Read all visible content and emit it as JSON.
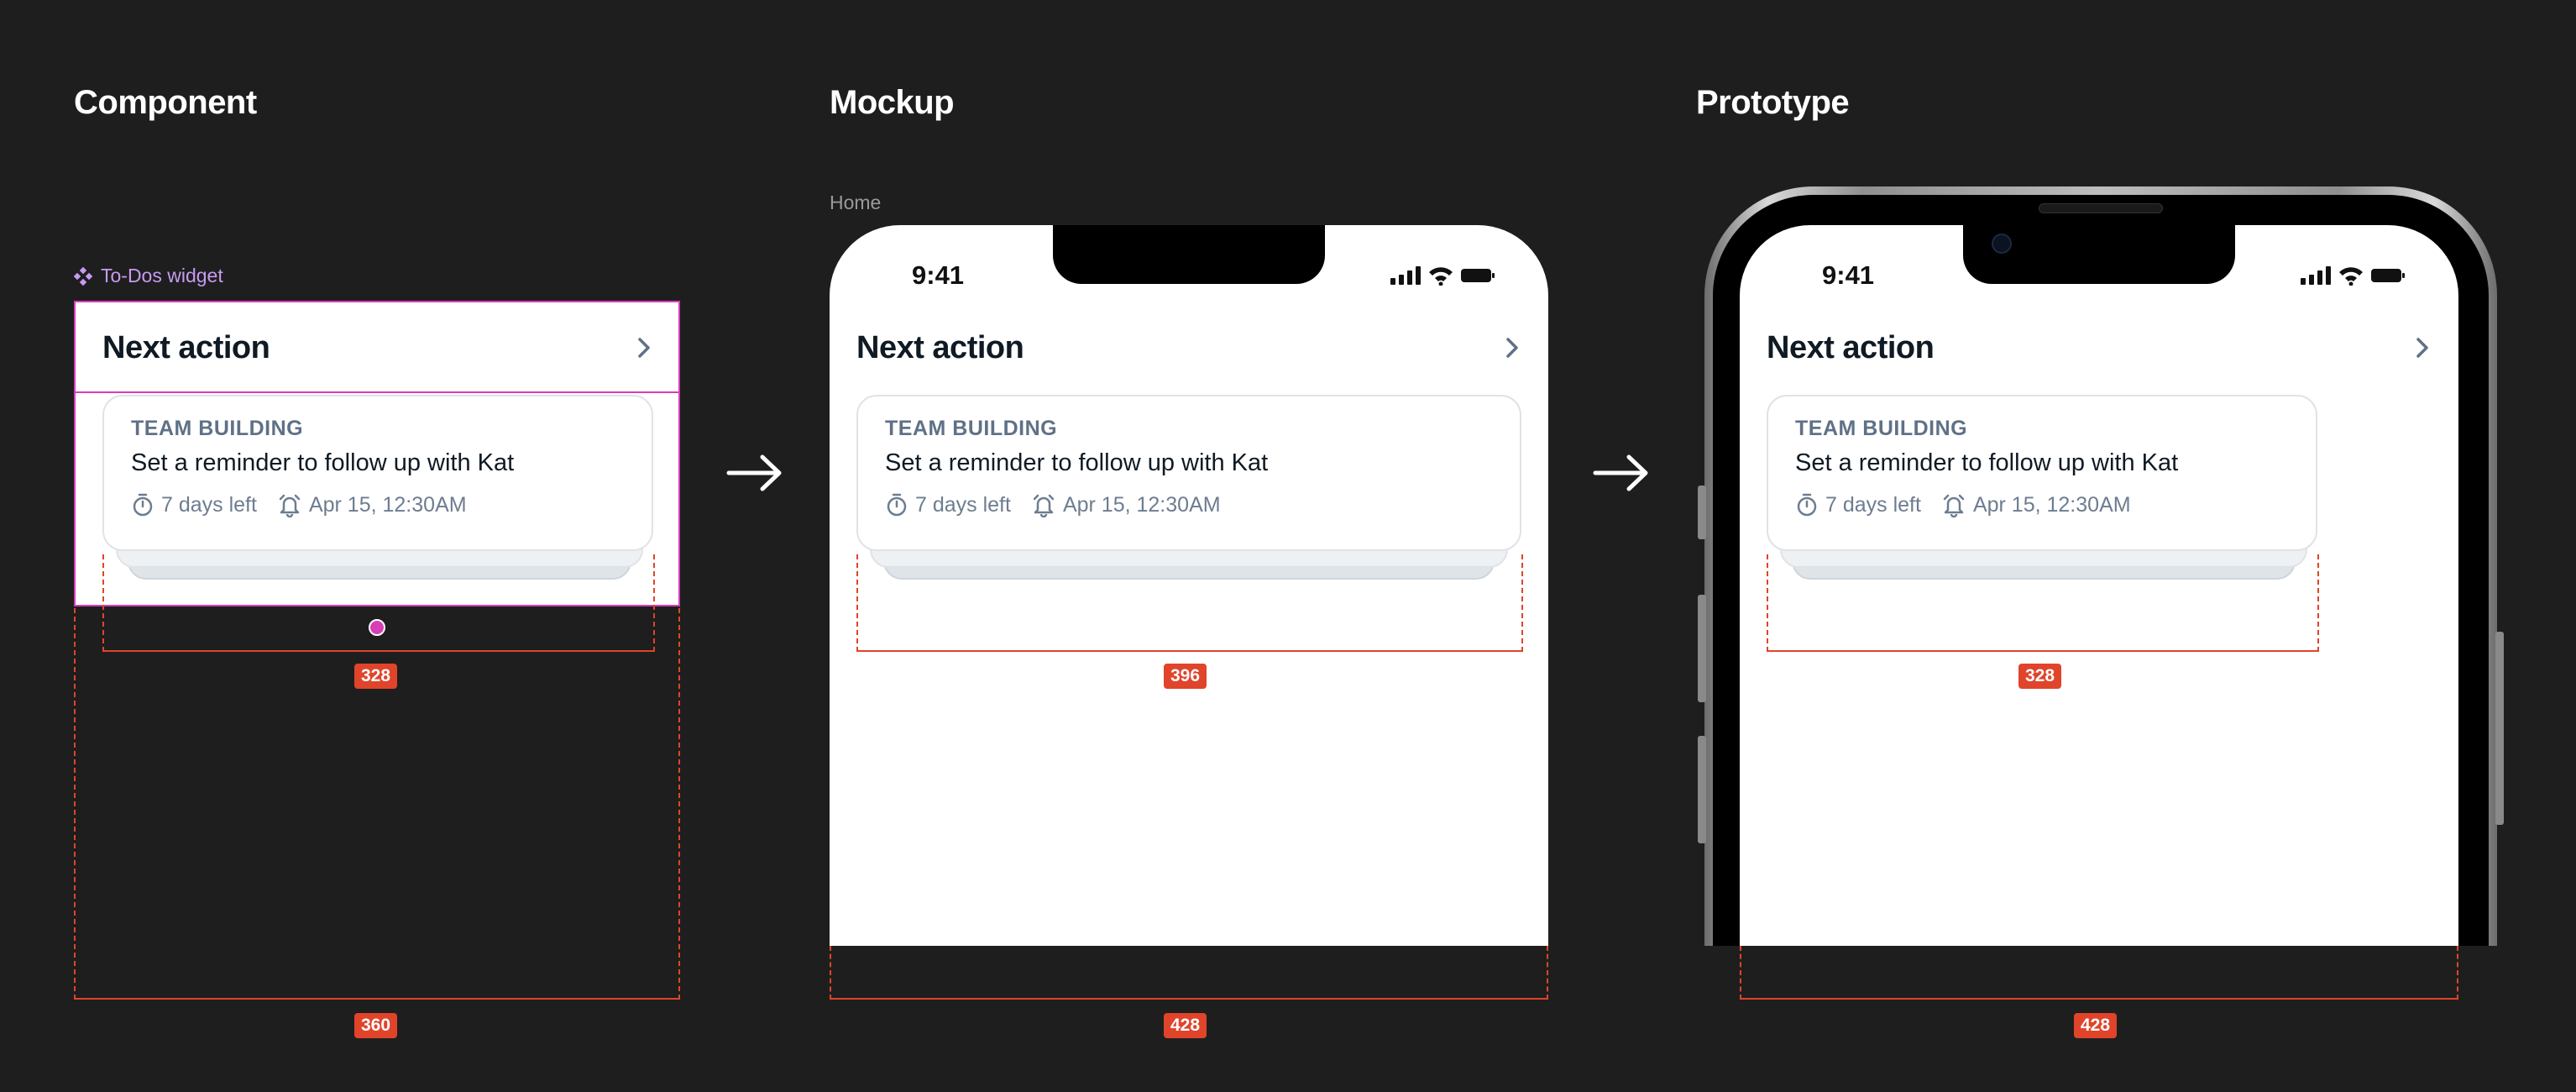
{
  "sections": {
    "component": {
      "title": "Component",
      "layer_label": "To-Dos widget"
    },
    "mockup": {
      "title": "Mockup",
      "frame_label": "Home"
    },
    "prototype": {
      "title": "Prototype"
    }
  },
  "status_bar": {
    "time": "9:41"
  },
  "widget": {
    "title": "Next action",
    "card": {
      "category": "TEAM BUILDING",
      "task": "Set a reminder to follow up with Kat",
      "time_left": "7 days left",
      "reminder": "Apr 15, 12:30AM"
    }
  },
  "dimensions": {
    "component_card_width": "328",
    "component_frame_width": "360",
    "mockup_card_width": "396",
    "mockup_frame_width": "428",
    "prototype_card_width": "328",
    "prototype_frame_width": "428"
  },
  "colors": {
    "background": "#1e1e1e",
    "dimension": "#e0442a",
    "selection": "#d63fb6",
    "component_label": "#c79bf2",
    "category_text": "#5f7187"
  },
  "icons": {
    "component": "component-icon",
    "chevron": "chevron-right-icon",
    "timer": "timer-icon",
    "alarm": "alarm-icon",
    "arrow": "arrow-right-icon",
    "signal": "signal-icon",
    "wifi": "wifi-icon",
    "battery": "battery-icon"
  }
}
